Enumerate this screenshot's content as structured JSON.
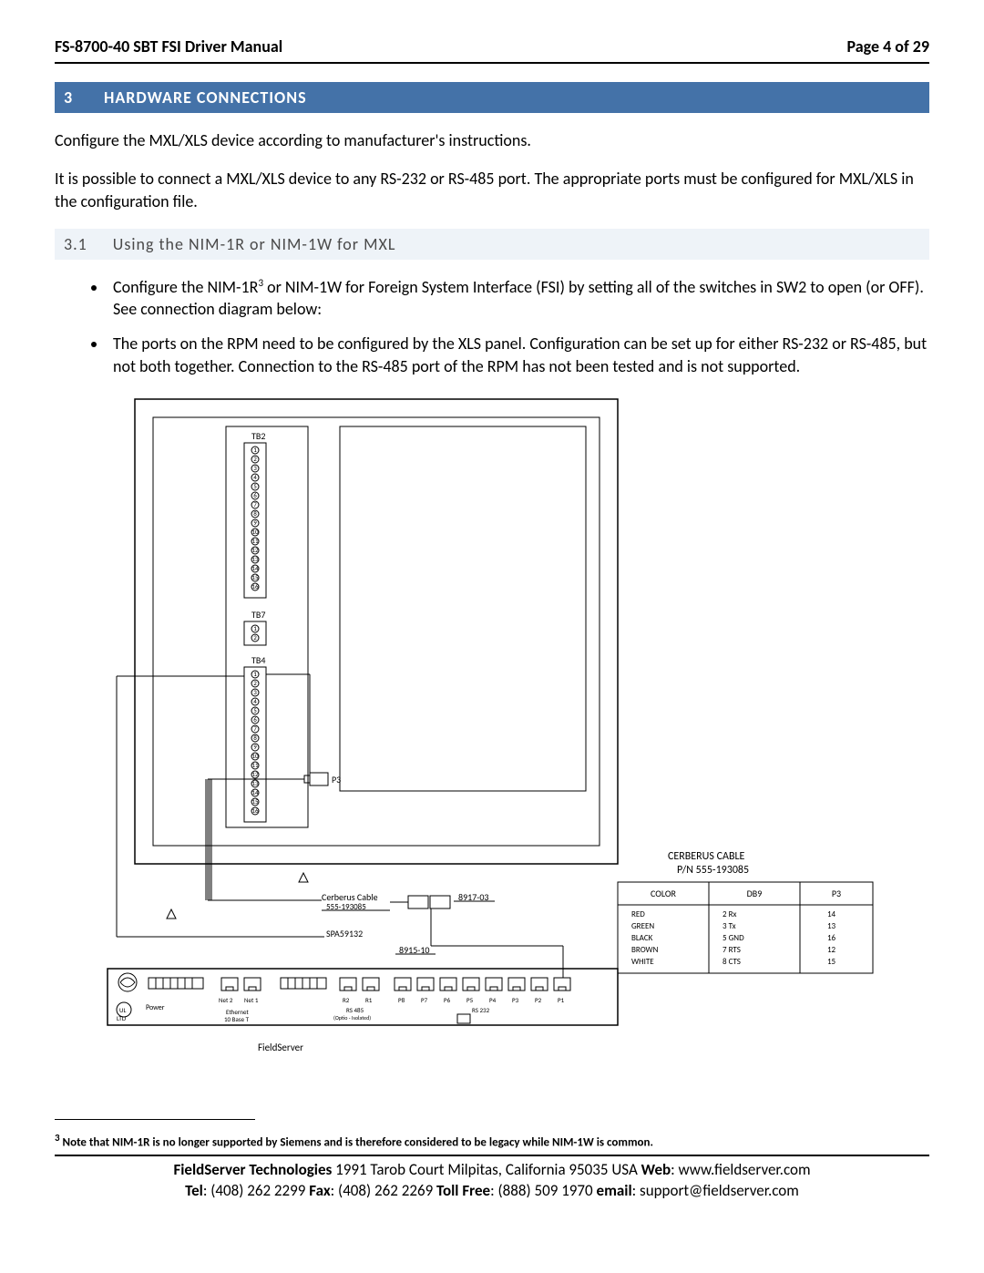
{
  "header": {
    "title": "FS-8700-40 SBT FSI Driver Manual",
    "page": "Page 4 of 29"
  },
  "section": {
    "num": "3",
    "title": "HARDWARE CONNECTIONS"
  },
  "para1": "Configure the MXL/XLS device according to manufacturer's instructions.",
  "para2": "It is possible to connect a MXL/XLS device to any RS-232 or RS-485 port.  The appropriate ports must be configured for MXL/XLS in the configuration file.",
  "subsection": {
    "num": "3.1",
    "title": "Using the NIM-1R or NIM-1W for MXL"
  },
  "bullet1_a": "Configure the NIM-1R",
  "bullet1_sup": "3",
  "bullet1_b": "  or NIM-1W for Foreign System Interface (FSI) by setting all of the switches in SW2 to open (or OFF).  See connection diagram below:",
  "bullet2": "The ports on the RPM need to be configured by the XLS panel.  Configuration can be set up for either RS-232 or RS-485, but not both together.  Connection to the RS-485 port of the RPM has not been tested and is not supported.",
  "diagram": {
    "tb2": "TB2",
    "tb7": "TB7",
    "tb4": "TB4",
    "p3": "P3",
    "cerberus_cable_lbl": "Cerberus Cable",
    "cerberus_cable_pn_small": "555-193085",
    "spa": "SPA59132",
    "conn_8917": "8917-03",
    "conn_8915": "8915-10",
    "fieldserver_label": "FieldServer",
    "fs_power": "Power",
    "fs_net2": "Net 2",
    "fs_net1": "Net 1",
    "fs_eth": "Ethernet\n10 Base T",
    "fs_r2": "R2",
    "fs_r1": "R1",
    "fs_rs485": "RS 485",
    "fs_serial": "(Optio - Isolated)",
    "fs_p8": "P8",
    "fs_p7": "P7",
    "fs_p6": "P6",
    "fs_p5": "P5",
    "fs_p4": "P4",
    "fs_p3": "P3",
    "fs_p2": "P2",
    "fs_p1": "P1",
    "fs_rs232": "RS 232",
    "ul": "UL",
    "listed": "LTD",
    "cable_title1": "CERBERUS CABLE",
    "cable_title2": "P/N 555-193085",
    "table": {
      "headers": [
        "COLOR",
        "DB9",
        "P3"
      ],
      "rows": [
        [
          "RED",
          "2 Rx",
          "14"
        ],
        [
          "GREEN",
          "3 Tx",
          "13"
        ],
        [
          "BLACK",
          "5 GND",
          "16"
        ],
        [
          "BROWN",
          "7 RTS",
          "12"
        ],
        [
          "WHITE",
          "8 CTS",
          "15"
        ]
      ]
    }
  },
  "footnote_sup": "3",
  "footnote": " Note that NIM-1R is no longer supported by Siemens and is therefore considered to be legacy while NIM-1W is common.",
  "footer": {
    "company": "FieldServer Technologies",
    "addr": " 1991 Tarob Court Milpitas, California 95035 USA   ",
    "web_lbl": "Web",
    "web": ": www.fieldserver.com",
    "tel_lbl": "Tel",
    "tel": ": (408) 262 2299   ",
    "fax_lbl": "Fax",
    "fax": ": (408) 262 2269   ",
    "toll_lbl": "Toll Free",
    "toll": ": (888) 509 1970   ",
    "email_lbl": "email",
    "email": ": support@fieldserver.com"
  }
}
